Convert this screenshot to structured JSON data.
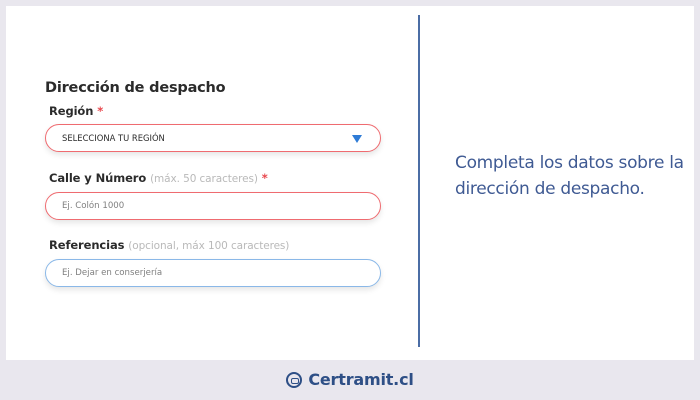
{
  "form": {
    "title": "Dirección de despacho",
    "region": {
      "label": "Región",
      "required_mark": "*",
      "value": "SELECCIONA TU REGIÓN"
    },
    "street": {
      "label": "Calle y Número",
      "hint": "(máx. 50 caracteres)",
      "required_mark": "*",
      "placeholder": "Ej. Colón 1000"
    },
    "references": {
      "label": "Referencias",
      "hint": "(opcional, máx 100 caracteres)",
      "placeholder": "Ej. Dejar en conserjería"
    }
  },
  "description": "Completa los datos sobre la dirección de despacho.",
  "brand": {
    "name": "Certramit.cl",
    "icon": "certramit-logo-icon"
  },
  "colors": {
    "error_border": "#ef6b70",
    "focus_border": "#8ab8e8",
    "required": "#e8474d",
    "description_text": "#3f5a93",
    "brand": "#2e4f86",
    "caret": "#2e7bd6"
  }
}
